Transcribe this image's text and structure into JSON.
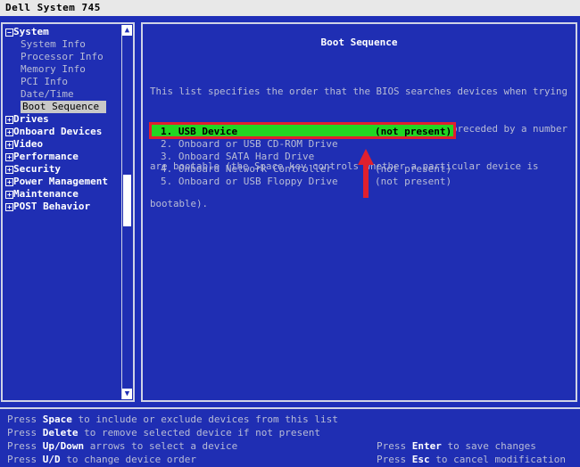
{
  "window": {
    "title": "Dell System 745"
  },
  "tree": [
    {
      "label": "System",
      "expanded": true,
      "children": [
        "System Info",
        "Processor Info",
        "Memory Info",
        "PCI Info",
        "Date/Time",
        "Boot Sequence"
      ]
    },
    {
      "label": "Drives"
    },
    {
      "label": "Onboard Devices"
    },
    {
      "label": "Video"
    },
    {
      "label": "Performance"
    },
    {
      "label": "Security"
    },
    {
      "label": "Power Management"
    },
    {
      "label": "Maintenance"
    },
    {
      "label": "POST Behavior"
    }
  ],
  "tree_selected": "Boot Sequence",
  "main": {
    "title": "Boot Sequence",
    "description": [
      "This list specifies the order that the BIOS searches devices when trying",
      "to find an operating system.  Only devices that are preceded by a number",
      "are bootable (the Space key controls whether a particular device is",
      "bootable)."
    ],
    "devices": [
      {
        "label": "1. USB Device",
        "status": "(not present)",
        "selected": true
      },
      {
        "label": "2. Onboard or USB CD-ROM Drive",
        "status": ""
      },
      {
        "label": "3. Onboard SATA Hard Drive",
        "status": ""
      },
      {
        "label": "4. Onboard Network Controller",
        "status": "(not present)"
      },
      {
        "label": "5. Onboard or USB Floppy Drive",
        "status": "(not present)"
      }
    ]
  },
  "help": {
    "left": [
      {
        "pre": "Press ",
        "key": "Space",
        "post": " to include or exclude devices from this list"
      },
      {
        "pre": "Press ",
        "key": "Delete",
        "post": " to remove selected device if not present"
      },
      {
        "pre": "Press ",
        "key": "Up/Down",
        "post": " arrows to select a device"
      },
      {
        "pre": "Press ",
        "key": "U/D",
        "post": " to change device order"
      }
    ],
    "right": [
      {
        "pre": "Press ",
        "key": "Enter",
        "post": " to save changes"
      },
      {
        "pre": "Press ",
        "key": "Esc",
        "post": " to cancel modification"
      }
    ]
  },
  "colors": {
    "background": "#1f2eb3",
    "selection": "#22d622",
    "highlight_frame": "#e0202e"
  },
  "icons": {
    "scroll_up": "arrow-up-icon",
    "scroll_down": "arrow-down-icon",
    "expand": "tree-toggle-icon",
    "pointer": "red-up-arrow-annotation"
  }
}
